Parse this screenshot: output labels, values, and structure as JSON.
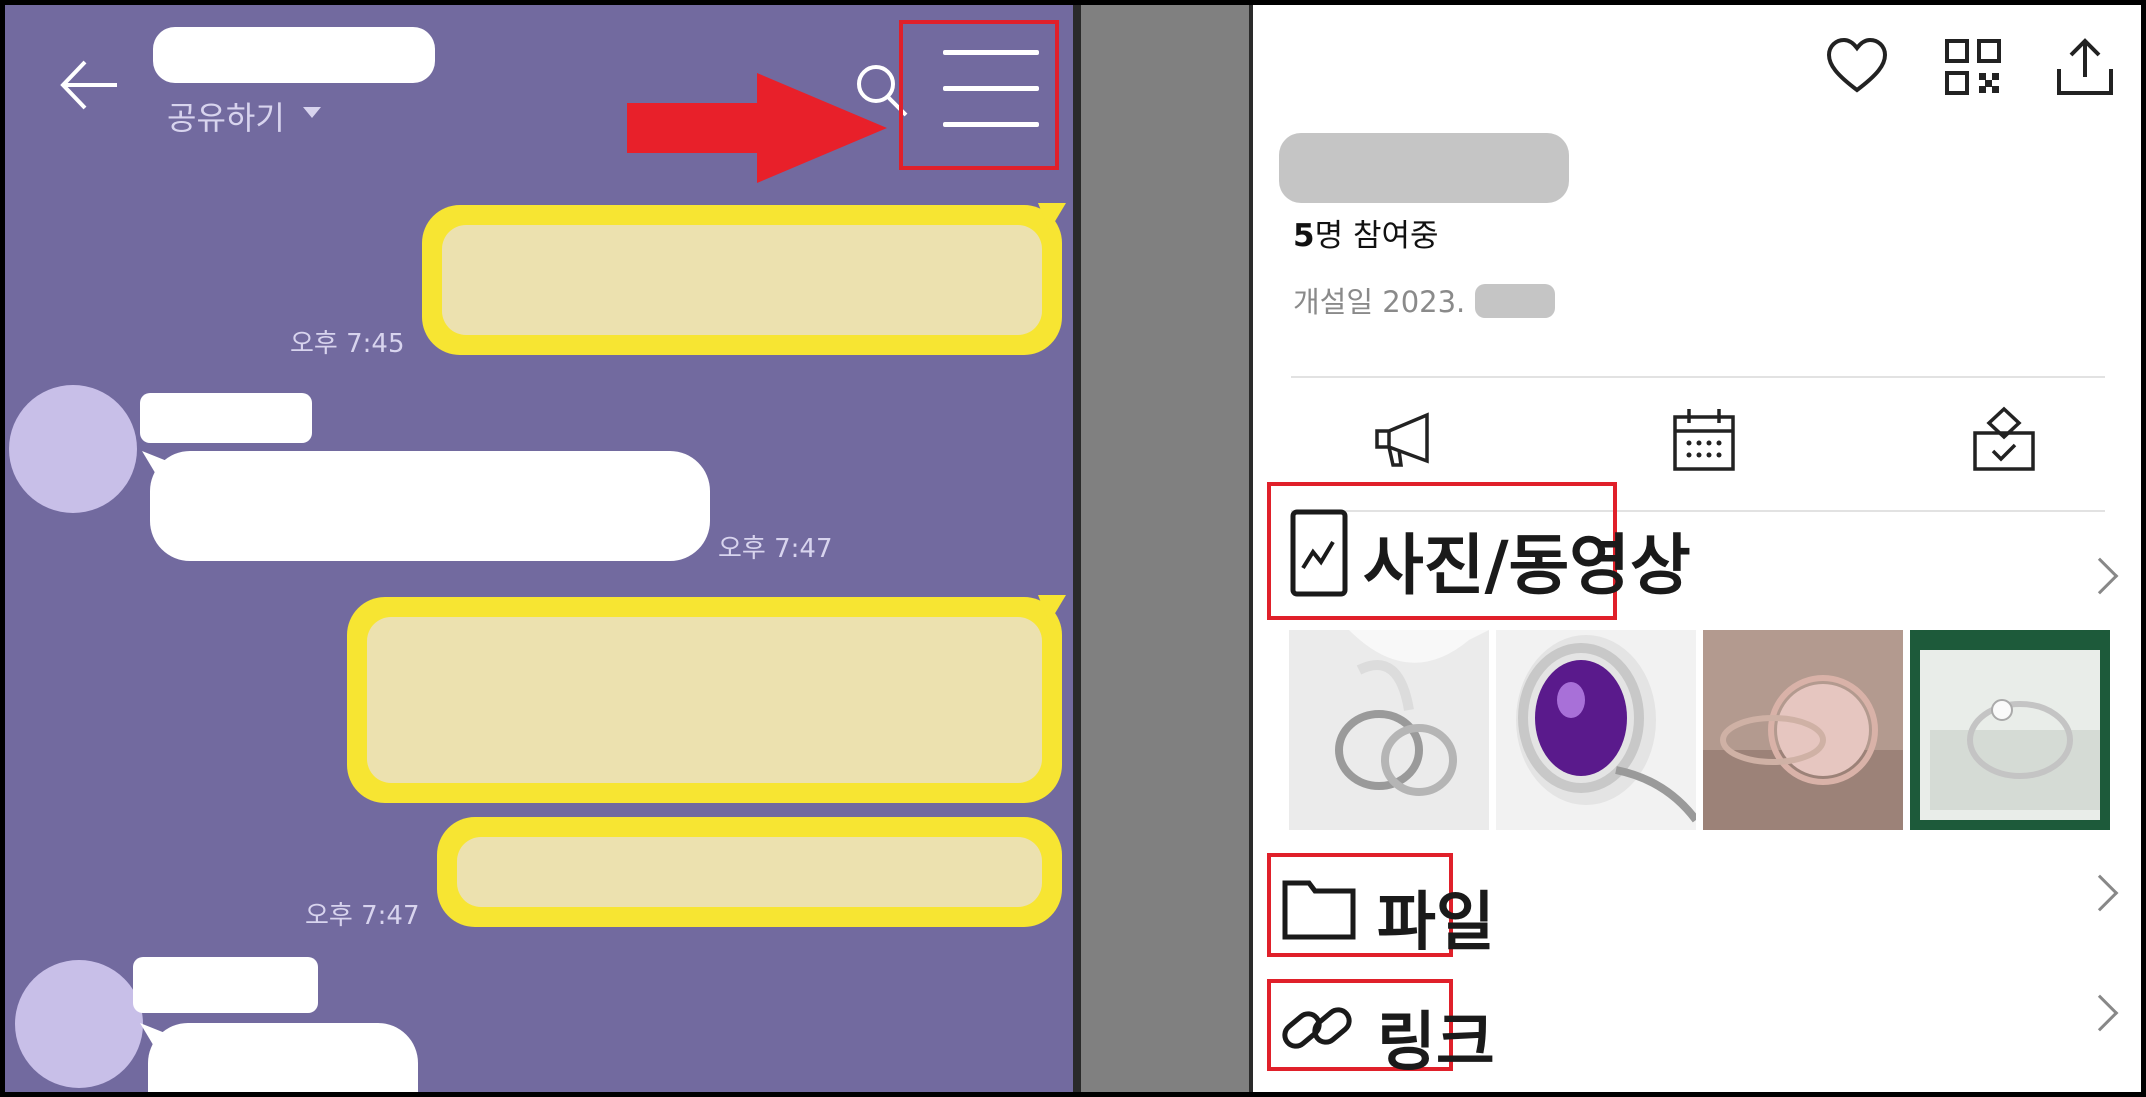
{
  "chat": {
    "share_label": "공유하기",
    "messages": [
      {
        "direction": "out",
        "time": "오후 7:45"
      },
      {
        "direction": "in",
        "time": "오후 7:47"
      },
      {
        "direction": "out",
        "time": ""
      },
      {
        "direction": "out",
        "time": "오후 7:47"
      },
      {
        "direction": "in",
        "time": ""
      }
    ],
    "colors": {
      "background": "#726a9f",
      "outgoing": "#f7e532",
      "highlight": "#e0202a"
    }
  },
  "info": {
    "members_count": "5",
    "members_suffix": "명 참여중",
    "created_label": "개설일 2023.",
    "tools": [
      "megaphone-icon",
      "calendar-icon",
      "vote-icon"
    ],
    "sections": {
      "media": "사진/동영상",
      "files": "파일",
      "links": "링크"
    },
    "thumbnails": [
      "wedding-rings-photo",
      "amethyst-ring-photo",
      "rose-quartz-ring-photo",
      "diamond-ring-box-photo"
    ]
  }
}
